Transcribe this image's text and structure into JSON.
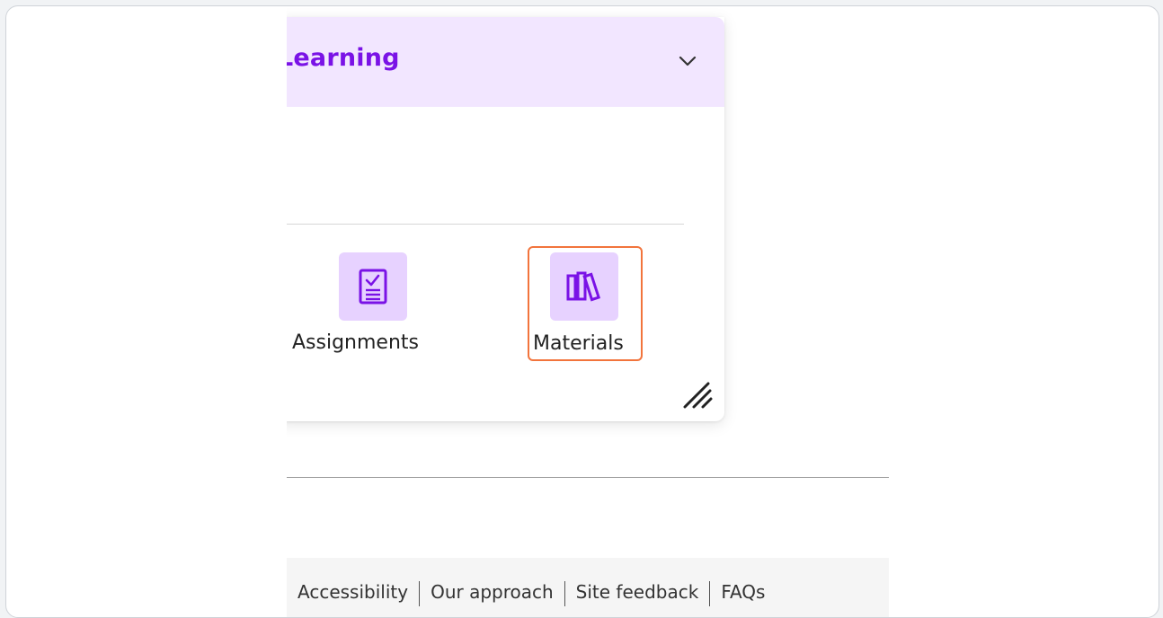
{
  "widget": {
    "title": "Learning",
    "tiles": [
      {
        "label": "Assignments",
        "icon": "assignment-checklist-icon"
      },
      {
        "label": "Materials",
        "icon": "books-icon"
      }
    ]
  },
  "footer": {
    "links": [
      "Accessibility",
      "Our approach",
      "Site feedback",
      "FAQs"
    ]
  },
  "colors": {
    "accent": "#7a12e6",
    "header_bg": "#f2e6ff",
    "tile_bg": "#e7d2ff",
    "highlight": "#f2743c"
  }
}
